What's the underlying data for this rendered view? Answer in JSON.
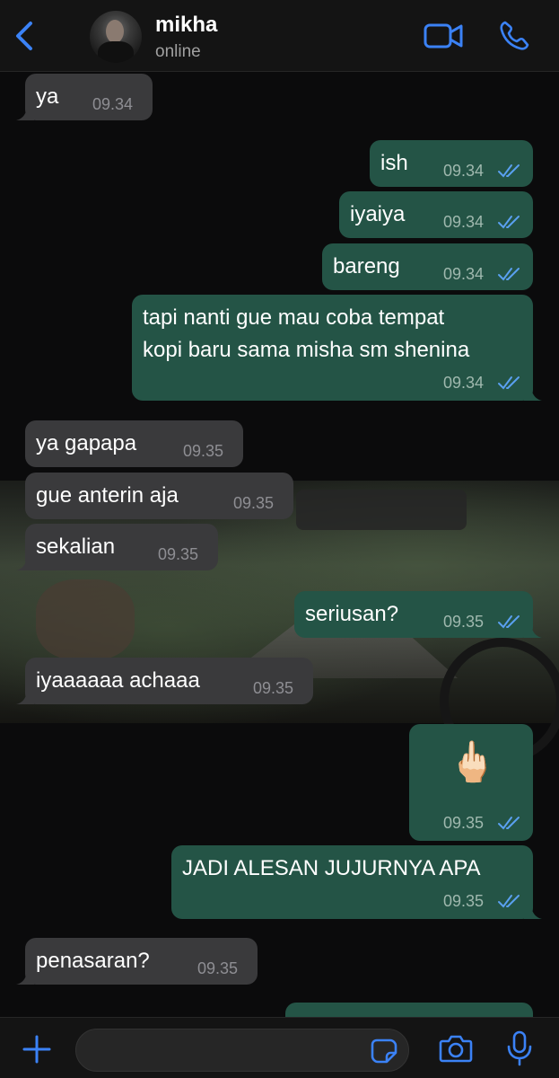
{
  "header": {
    "contact_name": "mikha",
    "status": "online",
    "icons": [
      "back-chevron-icon",
      "video-call-icon",
      "phone-call-icon"
    ]
  },
  "messages": [
    {
      "dir": "in",
      "text": "ya",
      "time": "09.34"
    },
    {
      "dir": "out",
      "text": "ish",
      "time": "09.34",
      "read": true
    },
    {
      "dir": "out",
      "text": "iyaiya",
      "time": "09.34",
      "read": true
    },
    {
      "dir": "out",
      "text": "bareng",
      "time": "09.34",
      "read": true
    },
    {
      "dir": "out",
      "text": "tapi nanti gue mau coba tempat\nkopi baru sama misha sm shenina",
      "time": "09.34",
      "read": true
    },
    {
      "dir": "in",
      "text": "ya gapapa",
      "time": "09.35"
    },
    {
      "dir": "in",
      "text": "gue anterin aja",
      "time": "09.35"
    },
    {
      "dir": "in",
      "text": "sekalian",
      "time": "09.35"
    },
    {
      "dir": "out",
      "text": "seriusan?",
      "time": "09.35",
      "read": true
    },
    {
      "dir": "in",
      "text": "iyaaaaaa achaaa",
      "time": "09.35"
    },
    {
      "dir": "out",
      "text": "🖕🏻",
      "time": "09.35",
      "read": true
    },
    {
      "dir": "out",
      "text": "JADI ALESAN JUJURNYA APA",
      "time": "09.35",
      "read": true
    },
    {
      "dir": "in",
      "text": "penasaran?",
      "time": "09.35"
    }
  ],
  "composer": {
    "placeholder": "",
    "icons": [
      "plus-icon",
      "sticker-icon",
      "camera-icon",
      "microphone-icon"
    ]
  },
  "colors": {
    "incoming_bubble": "#3a3a3c",
    "outgoing_bubble": "#245446",
    "accent": "#3b82f6",
    "read_ticks": "#5aa0f0"
  }
}
